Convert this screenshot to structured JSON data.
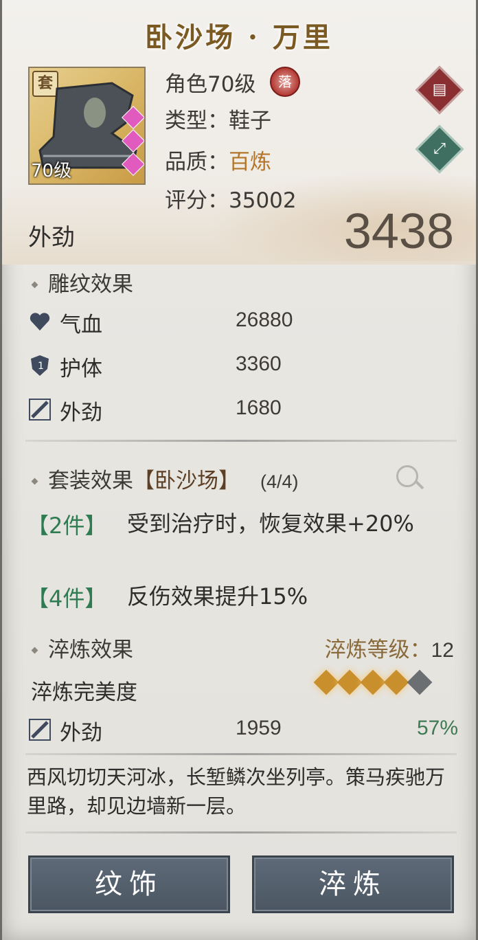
{
  "title": "卧沙场 · 万里",
  "item": {
    "badge": "套",
    "level_tag": "70级",
    "role_level": "角色70级",
    "fall_badge": "落",
    "type": "类型：鞋子",
    "quality_label": "品质：",
    "quality_value": "百炼",
    "score": "评分：35002"
  },
  "main_stat": {
    "label": "外劲",
    "value": "3438"
  },
  "engrave": {
    "title": "雕纹效果",
    "rows": [
      {
        "name": "气血",
        "value": "26880"
      },
      {
        "name": "护体",
        "value": "3360"
      },
      {
        "name": "外劲",
        "value": "1680"
      }
    ]
  },
  "set": {
    "title": "套装效果",
    "name": "【卧沙场】",
    "count": "(4/4)",
    "bonuses": [
      {
        "tag": "【2件】",
        "text": "受到治疗时，恢复效果+20%"
      },
      {
        "tag": "【4件】",
        "text": "反伤效果提升15%"
      }
    ]
  },
  "temper": {
    "title": "淬炼效果",
    "level_label": "淬炼等级：",
    "level_value": "12",
    "perfect_label": "淬炼完美度",
    "stars_filled": 4,
    "stars_total": 5,
    "stat_name": "外劲",
    "stat_value": "1959",
    "stat_pct": "57%"
  },
  "poem": "西风切切天河冰，长堑鳞次坐列亭。策马疾驰万里路，却见边墙新一层。",
  "buttons": {
    "left": "纹饰",
    "right": "淬炼"
  },
  "colors": {
    "quality": "#b3752a",
    "bonus_green": "#2f7b52",
    "button": "#56616e"
  }
}
